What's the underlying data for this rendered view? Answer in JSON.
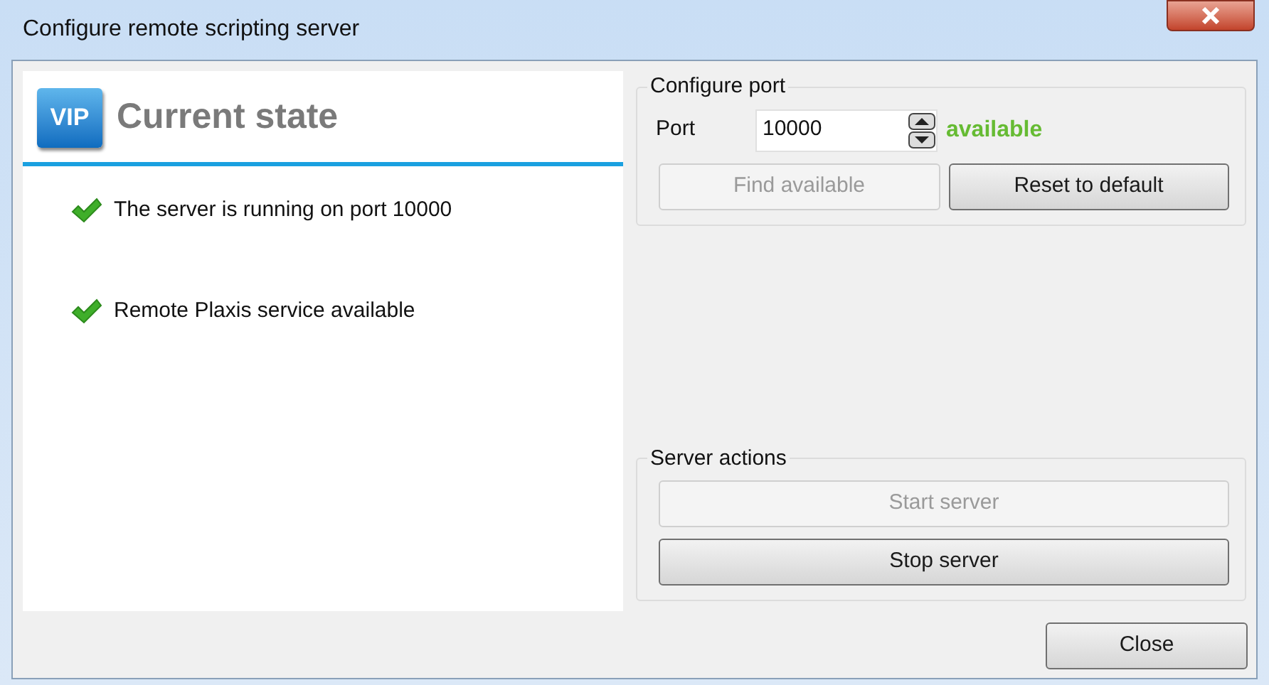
{
  "window": {
    "title": "Configure remote scripting server"
  },
  "state_panel": {
    "logo": "VIP",
    "heading": "Current state",
    "items": [
      {
        "text": "The server is running on port 10000",
        "ok": true
      },
      {
        "text": "Remote Plaxis service available",
        "ok": true
      }
    ]
  },
  "configure_port": {
    "title": "Configure port",
    "port_label": "Port",
    "port_value": "10000",
    "status": "available",
    "buttons": [
      {
        "label": "Find available",
        "disabled": true
      },
      {
        "label": "Reset to default",
        "disabled": false
      }
    ]
  },
  "server_actions": {
    "title": "Server actions",
    "buttons": [
      {
        "label": "Start server",
        "disabled": true
      },
      {
        "label": "Stop server",
        "disabled": false
      }
    ]
  },
  "footer_buttons": [
    {
      "label": "Close",
      "disabled": false
    }
  ]
}
